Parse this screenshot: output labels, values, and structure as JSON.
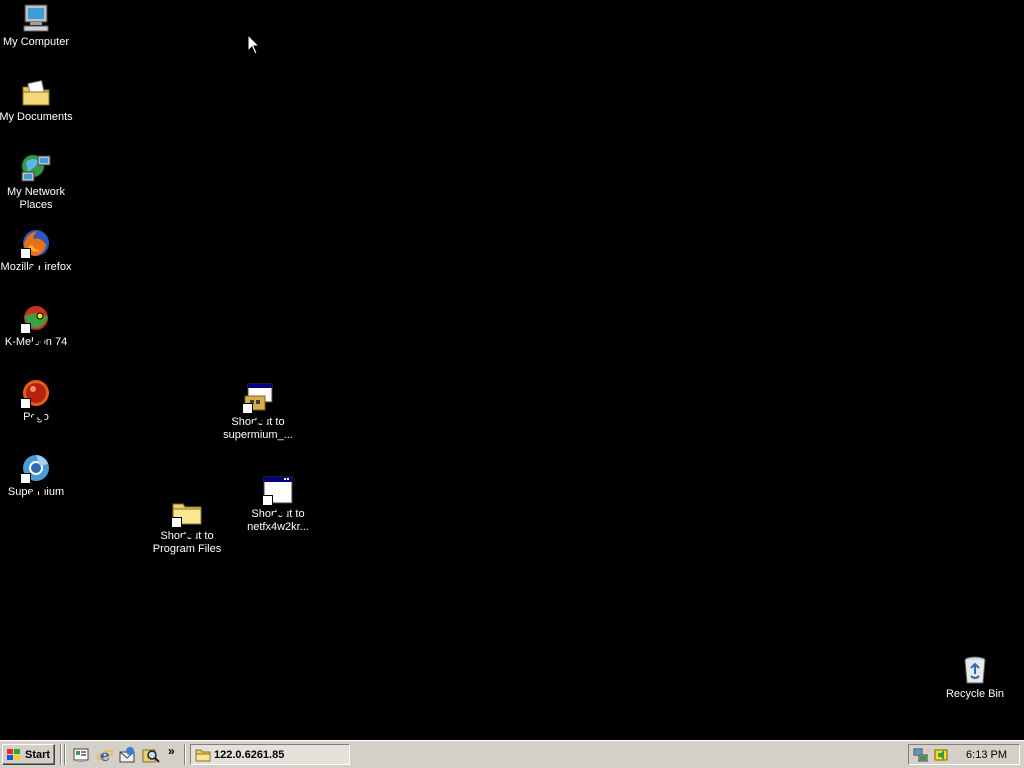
{
  "desktop": {
    "icons": [
      {
        "label": "My Computer",
        "icon": "my-computer-icon"
      },
      {
        "label": "My Documents",
        "icon": "my-documents-icon"
      },
      {
        "label": "My Network\nPlaces",
        "icon": "network-places-icon"
      },
      {
        "label": "Mozilla Firefox",
        "icon": "firefox-icon"
      },
      {
        "label": "K-Meleon 74",
        "icon": "k-meleon-icon"
      },
      {
        "label": "Pego",
        "icon": "pego-icon"
      },
      {
        "label": "Supermium",
        "icon": "supermium-icon"
      },
      {
        "label": "Shortcut to\nsupermium_...",
        "icon": "installer-icon"
      },
      {
        "label": "Shortcut to\nnetfx4w2kr...",
        "icon": "window-app-icon"
      },
      {
        "label": "Shortcut to\nProgram Files",
        "icon": "folder-icon"
      },
      {
        "label": "Recycle Bin",
        "icon": "recycle-bin-icon"
      }
    ]
  },
  "taskbar": {
    "start_label": "Start",
    "quick_launch": [
      "show-desktop-icon",
      "internet-explorer-icon",
      "outlook-express-icon",
      "search-icon"
    ],
    "more_label": "»",
    "task_label": "122.0.6261.85",
    "tray_icons": [
      "network-tray-icon",
      "volume-tray-icon"
    ],
    "clock": "6:13 PM"
  },
  "colors": {
    "desktop_bg": "#000000",
    "taskbar_bg": "#d4d0c8",
    "label_text": "#ffffff"
  }
}
